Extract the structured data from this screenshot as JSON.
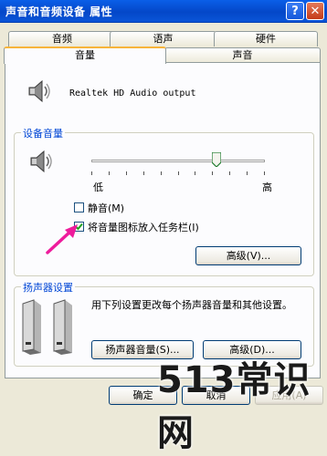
{
  "window": {
    "title": "声音和音频设备 属性",
    "help_glyph": "?",
    "close_glyph": "✕"
  },
  "tabs": {
    "row_back": [
      "音频",
      "语声",
      "硬件"
    ],
    "row_front": [
      "音量",
      "声音"
    ],
    "active": "音量"
  },
  "device": {
    "name": "Realtek HD Audio output",
    "icon": "speaker-icon"
  },
  "device_volume": {
    "legend": "设备音量",
    "low_label": "低",
    "high_label": "高",
    "level": 0.72,
    "mute_label": "静音(M)",
    "mute_checked": false,
    "tray_label": "将音量图标放入任务栏(I)",
    "tray_checked": true,
    "advanced_label": "高级(V)..."
  },
  "speaker_settings": {
    "legend": "扬声器设置",
    "description": "用下列设置更改每个扬声器音量和其他设置。",
    "speaker_volume_label": "扬声器音量(S)...",
    "advanced_label": "高级(D)..."
  },
  "footer": {
    "ok_label": "确定",
    "cancel_label": "取消",
    "apply_label": "应用(A)"
  },
  "watermark": "513常识网",
  "colors": {
    "titlebar": "#0447c8",
    "legend": "#0046d5",
    "arrow": "#ee1c9c"
  }
}
